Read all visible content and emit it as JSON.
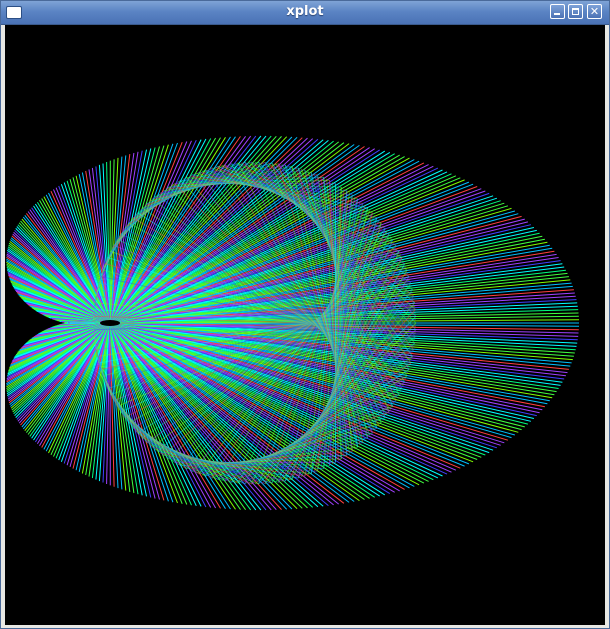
{
  "window": {
    "title": "xplot",
    "controls": {
      "minimize": "minimize-icon",
      "maximize": "maximize-icon",
      "close": "close-icon"
    }
  },
  "plot": {
    "background": "#000000",
    "curve": "cardioid",
    "line_colors": [
      "#00ffff",
      "#00ff80",
      "#40ff40",
      "#80ff00",
      "#00c0ff",
      "#ff4040",
      "#a040ff",
      "#4040ff"
    ]
  }
}
